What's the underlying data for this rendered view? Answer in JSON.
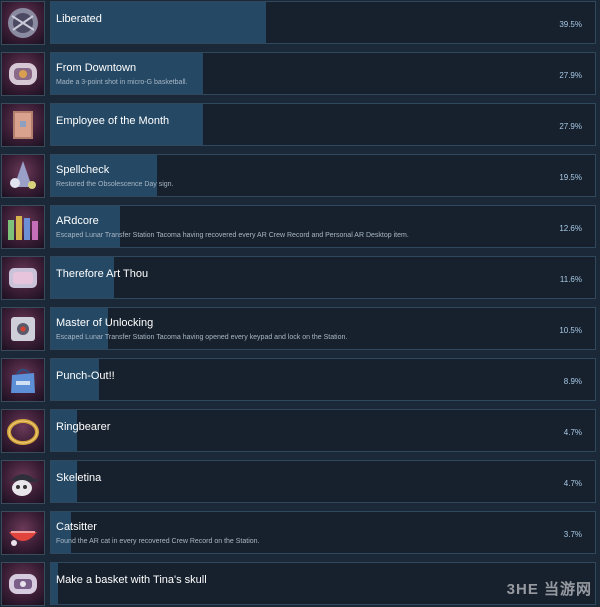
{
  "colors": {
    "background": "#1b2838",
    "bar_fill": "#254965",
    "percent_text": "#a8c9e6"
  },
  "achievements": [
    {
      "title": "Liberated",
      "description": "",
      "percent": "39.5%",
      "fill": 39.5,
      "icon": "orb-icon"
    },
    {
      "title": "From Downtown",
      "description": "Made a 3-point shot in micro-G basketball.",
      "percent": "27.9%",
      "fill": 27.9,
      "icon": "basketball-hoop-icon"
    },
    {
      "title": "Employee of the Month",
      "description": "",
      "percent": "27.9%",
      "fill": 27.9,
      "icon": "book-icon"
    },
    {
      "title": "Spellcheck",
      "description": "Restored the Obsolescence Day sign.",
      "percent": "19.5%",
      "fill": 19.5,
      "icon": "party-hat-icon"
    },
    {
      "title": "ARdcore",
      "description": "Escaped Lunar Transfer Station Tacoma having recovered every AR Crew Record and Personal AR Desktop item.",
      "percent": "12.6%",
      "fill": 12.6,
      "icon": "crew-figures-icon"
    },
    {
      "title": "Therefore Art Thou",
      "description": "",
      "percent": "11.6%",
      "fill": 11.6,
      "icon": "card-icon"
    },
    {
      "title": "Master of Unlocking",
      "description": "Escaped Lunar Transfer Station Tacoma having opened every keypad and lock on the Station.",
      "percent": "10.5%",
      "fill": 10.5,
      "icon": "keypad-icon"
    },
    {
      "title": "Punch-Out!!",
      "description": "",
      "percent": "8.9%",
      "fill": 8.9,
      "icon": "bag-icon"
    },
    {
      "title": "Ringbearer",
      "description": "",
      "percent": "4.7%",
      "fill": 4.7,
      "icon": "ring-icon"
    },
    {
      "title": "Skeletina",
      "description": "",
      "percent": "4.7%",
      "fill": 4.7,
      "icon": "skull-cap-icon"
    },
    {
      "title": "Catsitter",
      "description": "Found the AR cat in every recovered Crew Record on the Station.",
      "percent": "3.7%",
      "fill": 3.7,
      "icon": "cat-bed-icon"
    },
    {
      "title": "Make a basket with Tina's skull",
      "description": "",
      "percent": "",
      "fill": 1.2,
      "icon": "basket-icon"
    }
  ],
  "watermark": "3HE 当游网"
}
